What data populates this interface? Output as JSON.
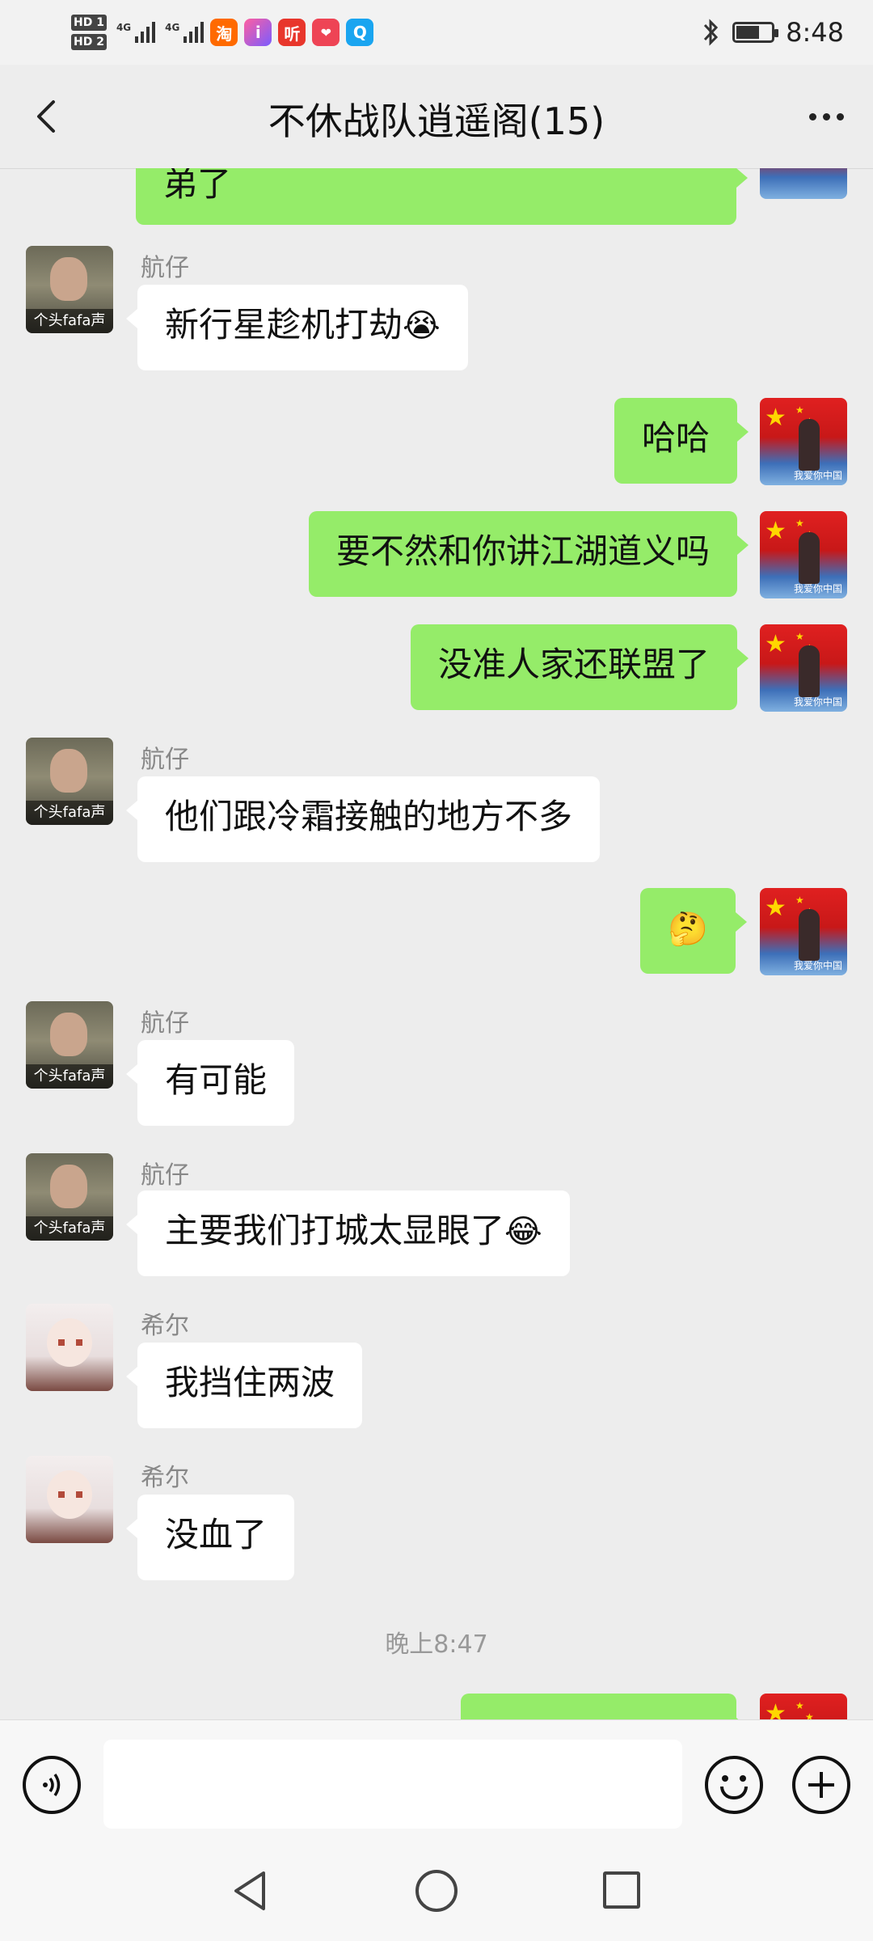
{
  "status_bar": {
    "sim1_label": "HD 1",
    "sim2_label": "HD 2",
    "network1": "4G",
    "network2": "4G",
    "app_icons": [
      "淘",
      "i",
      "听",
      "❤",
      "Q"
    ],
    "time": "8:48"
  },
  "header": {
    "title": "不休战队逍遥阁(15)"
  },
  "messages": [
    {
      "side": "out",
      "sender": "",
      "text": "弟了",
      "partial": true
    },
    {
      "side": "in",
      "sender": "航仔",
      "text": "新行星趁机打劫",
      "emoji": "😭"
    },
    {
      "side": "out",
      "sender": "",
      "text": "哈哈"
    },
    {
      "side": "out",
      "sender": "",
      "text": "要不然和你讲江湖道义吗"
    },
    {
      "side": "out",
      "sender": "",
      "text": "没准人家还联盟了"
    },
    {
      "side": "in",
      "sender": "航仔",
      "text": "他们跟冷霜接触的地方不多"
    },
    {
      "side": "out",
      "sender": "",
      "text": "",
      "emoji": "🤔"
    },
    {
      "side": "in",
      "sender": "航仔",
      "text": "有可能"
    },
    {
      "side": "in",
      "sender": "航仔",
      "text": "主要我们打城太显眼了",
      "emoji": "😂"
    },
    {
      "side": "in",
      "sender": "希尔",
      "text": "我挡住两波"
    },
    {
      "side": "in",
      "sender": "希尔",
      "text": "没血了"
    },
    {
      "side": "out",
      "sender": "",
      "text": "",
      "partial": true
    }
  ],
  "timestamp": "晚上8:47",
  "avatar_captions": {
    "hangzai": "个头fafa声",
    "me": "我爱你中国"
  },
  "input_bar": {
    "placeholder": ""
  },
  "colors": {
    "outgoing_bubble": "#95ec69",
    "incoming_bubble": "#ffffff",
    "background": "#ededed"
  }
}
